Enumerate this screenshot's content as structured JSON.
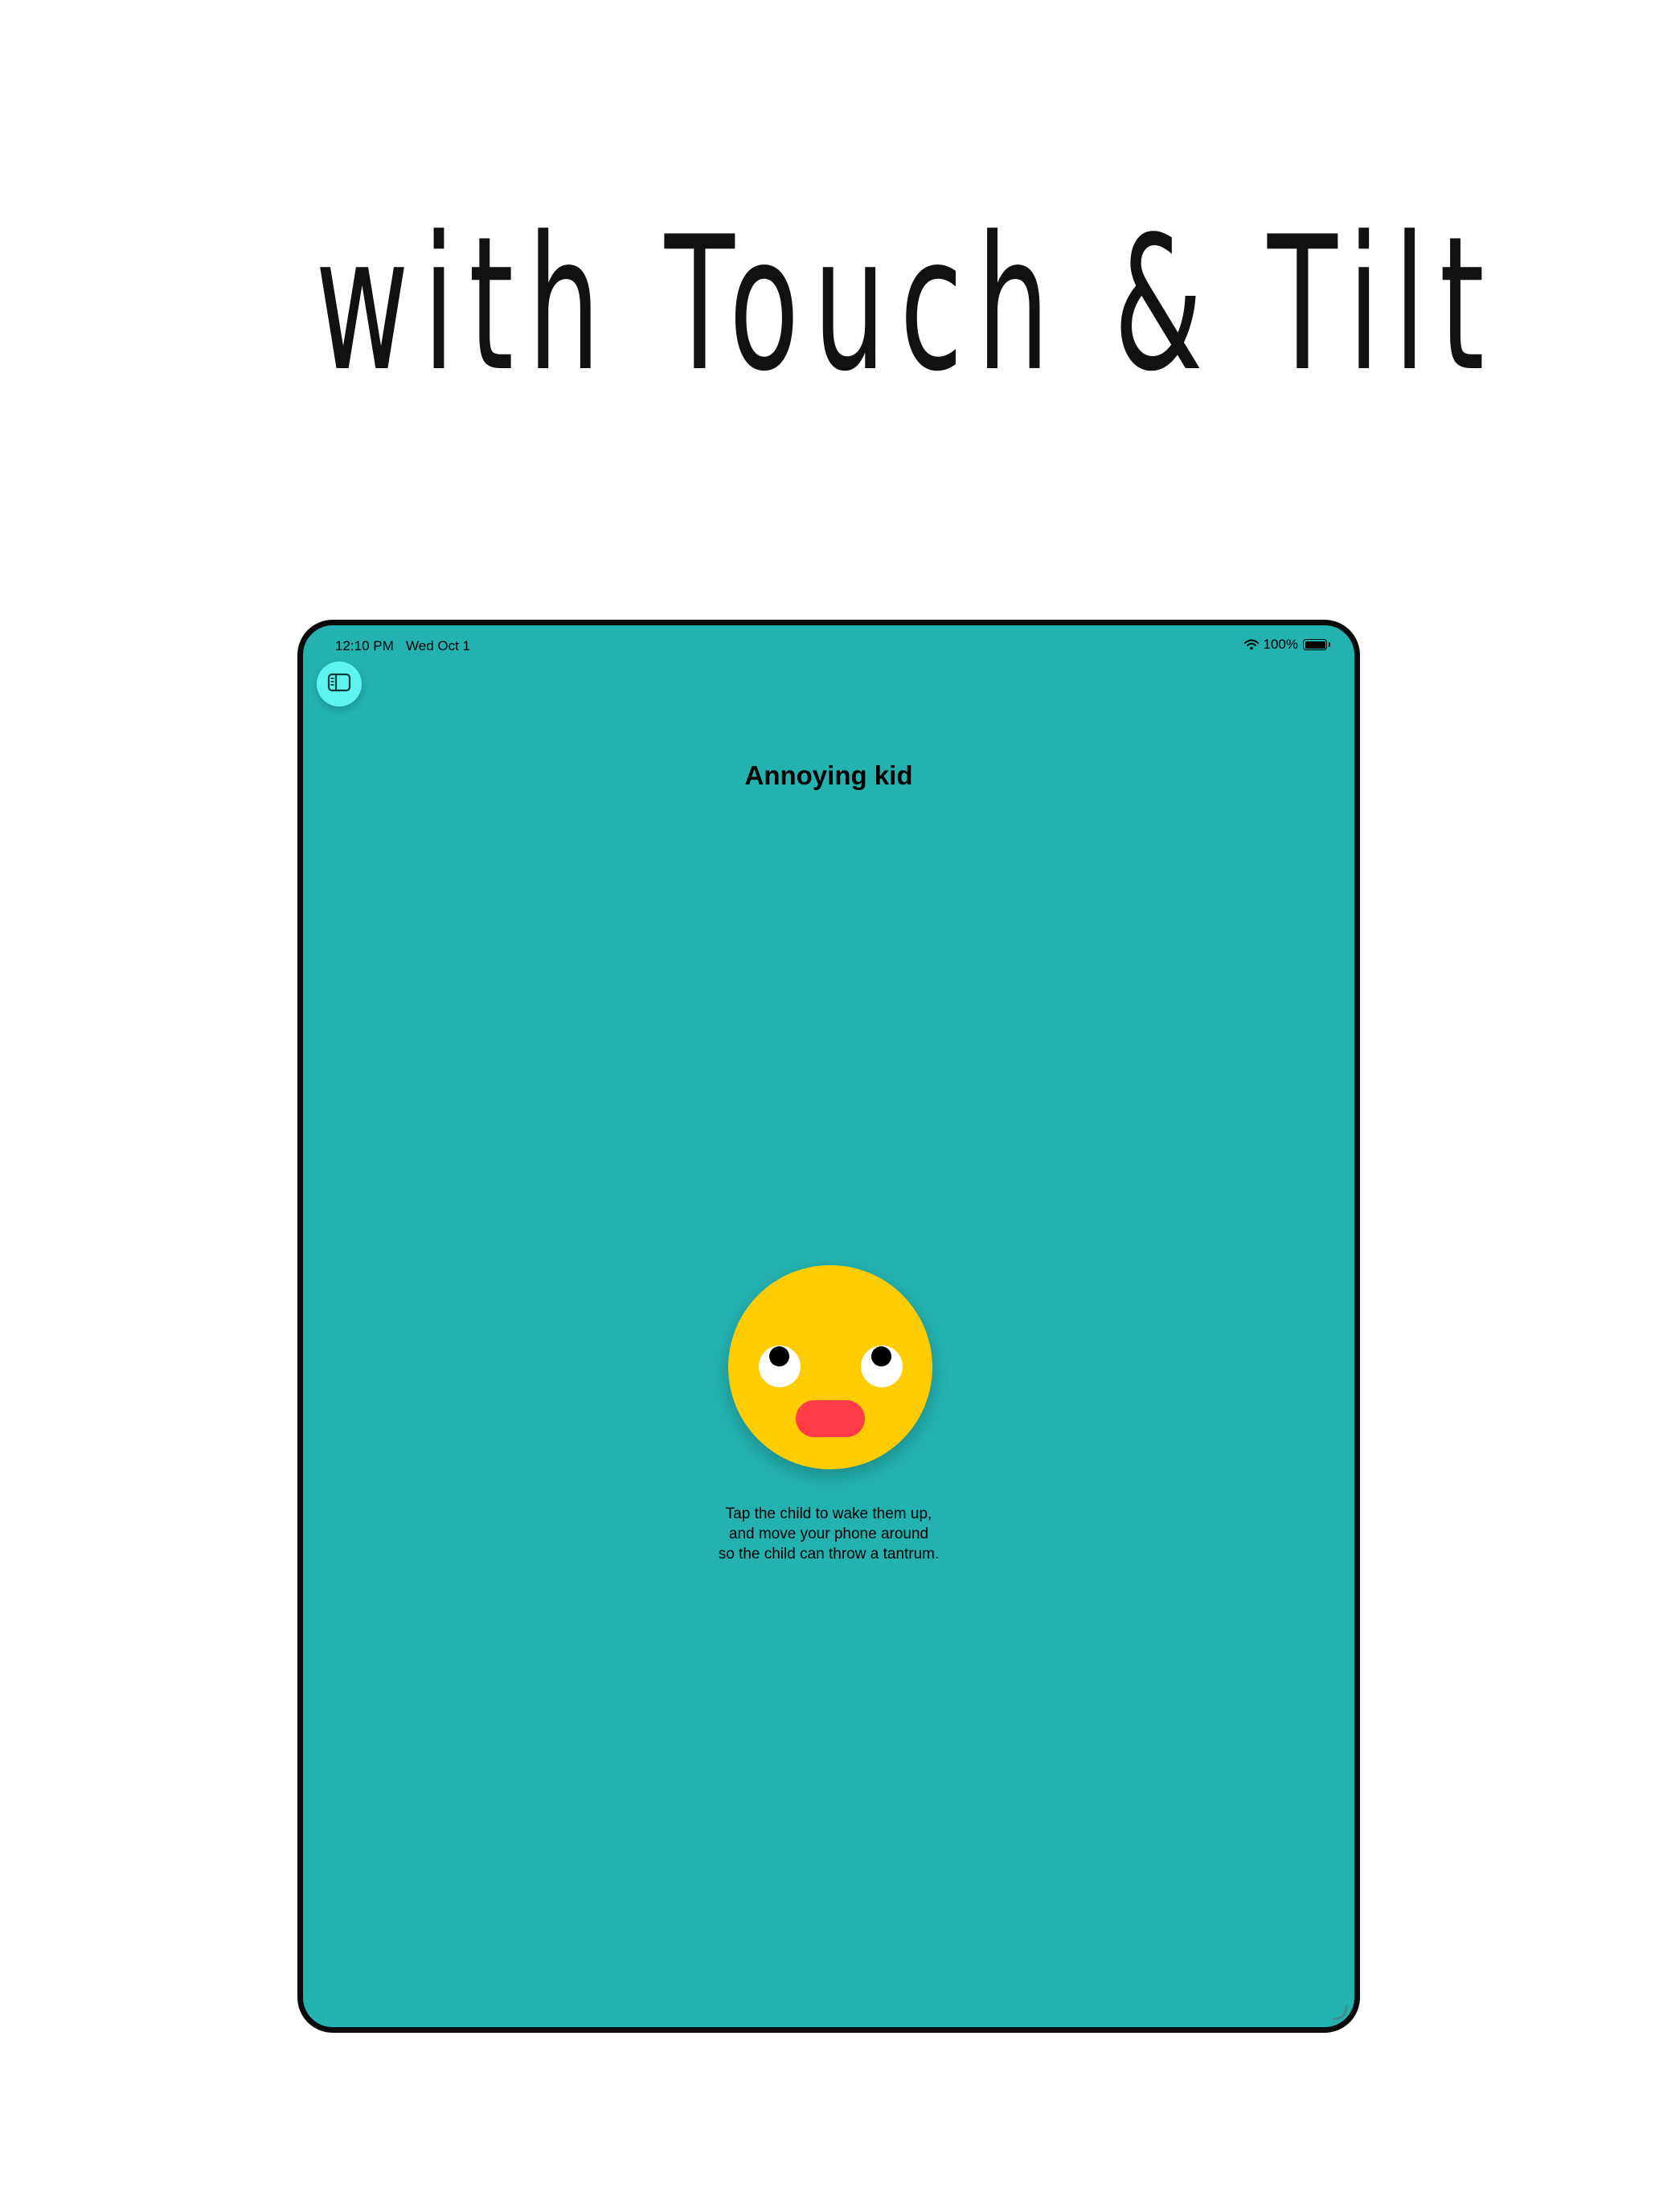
{
  "headline": "with Touch & Tilt",
  "status_bar": {
    "time": "12:10 PM",
    "date": "Wed Oct 1",
    "battery": "100%",
    "icons": [
      "wifi-icon",
      "battery-icon"
    ]
  },
  "toolbar": {
    "sidebar_icon": "sidebar-toggle-icon"
  },
  "nav": {
    "title": "Annoying kid"
  },
  "character": {
    "description_icon": "kid-face"
  },
  "instructions": {
    "lines": [
      "Tap the child to wake them up,",
      "and move your phone around",
      "so the child can throw a tantrum."
    ]
  },
  "colors": {
    "background": "#23b2b0",
    "accent": "#5ff3f0",
    "face": "#ffcc00",
    "mouth": "#ff3b45",
    "device_border": "#0a0a0a"
  }
}
